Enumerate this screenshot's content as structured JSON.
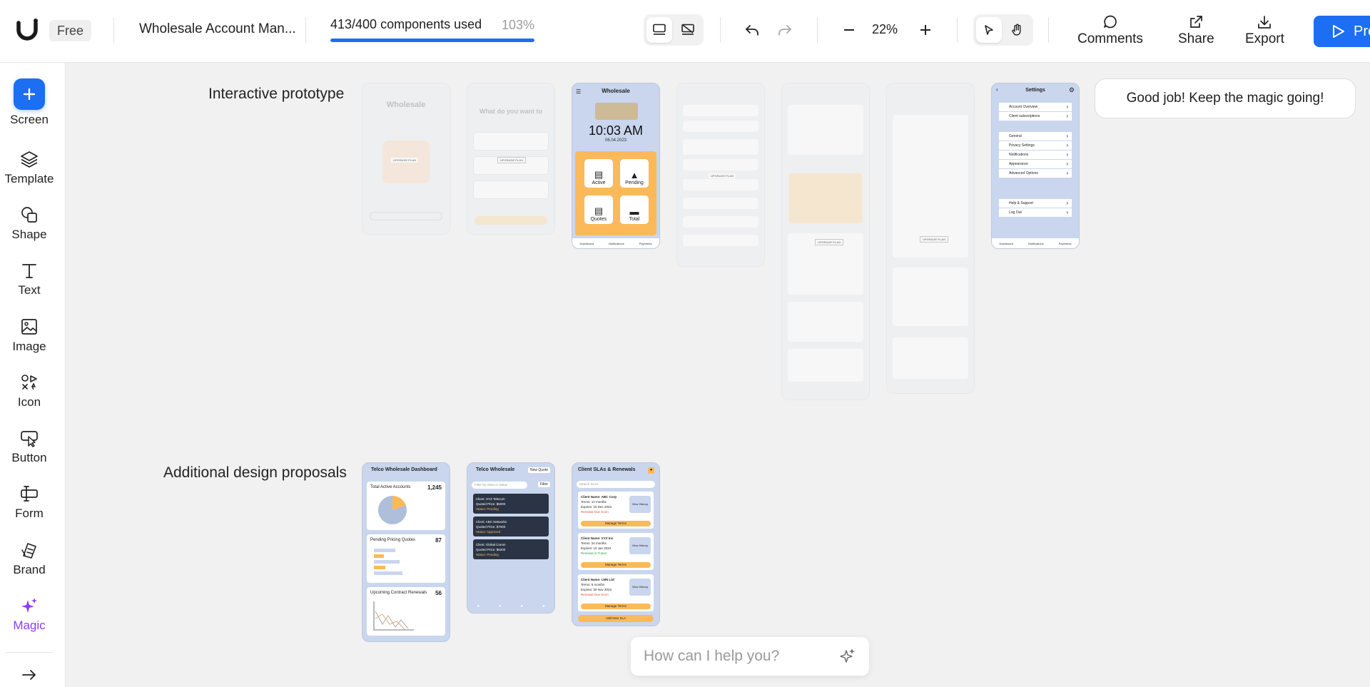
{
  "app": {
    "plan_badge": "Free",
    "project_name": "Wholesale Account Man..."
  },
  "usage": {
    "text": "413/400 components used",
    "percent_label": "103%",
    "fraction": 1.0
  },
  "toolbar": {
    "zoom": "22%",
    "comments_label": "Comments",
    "share_label": "Share",
    "export_label": "Export",
    "present_label": "Pre"
  },
  "sidebar": {
    "items": [
      {
        "label": "Screen",
        "icon": "plus-icon"
      },
      {
        "label": "Template",
        "icon": "layers-icon"
      },
      {
        "label": "Shape",
        "icon": "shape-icon"
      },
      {
        "label": "Text",
        "icon": "text-icon"
      },
      {
        "label": "Image",
        "icon": "image-icon"
      },
      {
        "label": "Icon",
        "icon": "icon-set-icon"
      },
      {
        "label": "Button",
        "icon": "button-cursor-icon"
      },
      {
        "label": "Form",
        "icon": "form-icon"
      },
      {
        "label": "Brand",
        "icon": "brand-icon"
      },
      {
        "label": "Magic",
        "icon": "sparkle-icon"
      }
    ]
  },
  "canvas": {
    "section1_label": "Interactive prototype",
    "section2_label": "Additional design proposals",
    "toast": "Good job! Keep the magic going!",
    "upgrade_badge": "UPGRADE PLAN",
    "phone1": {
      "title": "Wholesale"
    },
    "phone2": {
      "title": "What do you want to"
    },
    "phone3": {
      "title": "Wholesale",
      "time": "10:03 AM",
      "date": "06.04.2023",
      "cards": [
        "Active",
        "Pending",
        "Quotes",
        "Total"
      ],
      "nav": [
        "Dashboard",
        "Notifications",
        "Payments"
      ]
    },
    "settings": {
      "title": "Settings",
      "rows": [
        "Account Overview",
        "Client subscriptions",
        "General",
        "Privacy Settings",
        "Notifications",
        "Appearance",
        "Advanced Options",
        "Help & Support",
        "Log Out"
      ],
      "nav": [
        "Dashboard",
        "Notifications",
        "Payments"
      ]
    },
    "proposal1": {
      "title": "Telco Wholesale Dashboard",
      "cards": [
        {
          "label": "Total Active Accounts",
          "value": "1,245"
        },
        {
          "label": "Pending Pricing Quotes",
          "value": "87"
        },
        {
          "label": "Upcoming Contract Renewals",
          "value": "56"
        }
      ]
    },
    "proposal2": {
      "title": "Telco Wholesale",
      "action": "New Quote",
      "search_placeholder": "Filter by client or status",
      "filter": "Filter",
      "clients": [
        {
          "name": "Client: XYZ Telecom",
          "price": "Quoted Price: $5000",
          "status": "Status: Pending"
        },
        {
          "name": "Client: ABC Networks",
          "price": "Quoted Price: $7000",
          "status": "Status: Approved"
        },
        {
          "name": "Client: Global Comm",
          "price": "Quoted Price: $5200",
          "status": "Status: Pending"
        }
      ]
    },
    "proposal3": {
      "title": "Client SLAs & Renewals",
      "search_placeholder": "Search SLAs",
      "clients": [
        {
          "name": "Client Name: ABC Corp",
          "terms": "Terms: 12 months",
          "expires": "Expires: 15 Dec 2023",
          "status": "Renewal Due Soon"
        },
        {
          "name": "Client Name: XYZ Inc",
          "terms": "Terms: 24 months",
          "expires": "Expires: 10 Jan 2024",
          "status": "Renewal in Future"
        },
        {
          "name": "Client Name: LMN Ltd",
          "terms": "Terms: 6 months",
          "expires": "Expires: 30 Nov 2023",
          "status": "Renewal Due Soon"
        }
      ],
      "view_label": "View History",
      "manage_label": "Manage Terms",
      "add_label": "Add New SLA"
    },
    "chat_placeholder": "How can I help you?"
  },
  "colors": {
    "accent": "#1c6ef2",
    "magic": "#8b3dff",
    "orange": "#fbb95a",
    "phone_blue": "#c9d6ee"
  }
}
